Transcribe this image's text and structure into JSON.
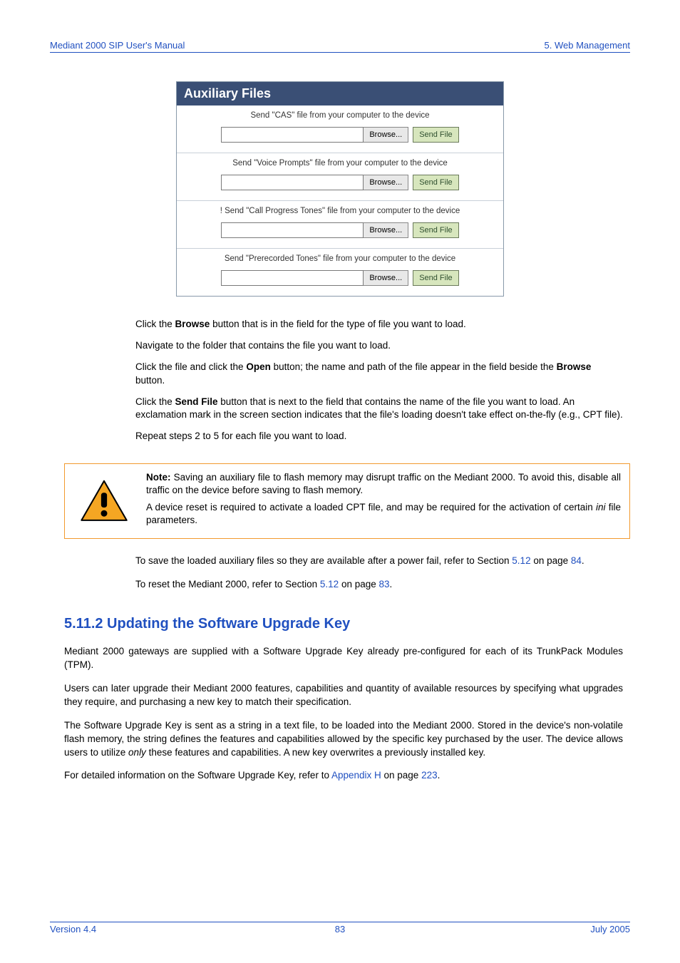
{
  "header": {
    "left": "Mediant 2000 SIP User's Manual",
    "right": "5. Web Management"
  },
  "aux": {
    "title": "Auxiliary Files",
    "sections": [
      {
        "label": "Send \"CAS\" file from your computer to the device",
        "browse": "Browse...",
        "send": "Send File"
      },
      {
        "label": "Send \"Voice Prompts\" file from your computer to the device",
        "browse": "Browse...",
        "send": "Send File"
      },
      {
        "label": "! Send \"Call Progress Tones\" file from your computer to the device",
        "browse": "Browse...",
        "send": "Send File"
      },
      {
        "label": "Send \"Prerecorded Tones\" file from your computer to the device",
        "browse": "Browse...",
        "send": "Send File"
      }
    ]
  },
  "steps": {
    "s2a": "Click the ",
    "s2b": "Browse",
    "s2c": " button that is in the field for the type of file you want to load.",
    "s3": "Navigate to the folder that contains the file you want to load.",
    "s4a": "Click the file and click the ",
    "s4b": "Open",
    "s4c": " button; the name and path of the file appear in the field beside the ",
    "s4d": "Browse",
    "s4e": " button.",
    "s5a": "Click the ",
    "s5b": "Send File",
    "s5c": " button that is next to the field that contains the name of the file you want to load. An exclamation mark in the screen section indicates that the file's loading doesn't take effect on-the-fly (e.g., CPT file).",
    "s6": "Repeat steps 2 to 5 for each file you want to load."
  },
  "note": {
    "label": "Note:",
    "p1": " Saving an auxiliary file to flash memory may disrupt traffic on the Mediant 2000. To avoid this, disable all traffic on the device before saving to flash memory.",
    "p2a": "A device reset is required to activate a loaded CPT file, and may be required for the activation of certain ",
    "p2b": "ini",
    "p2c": " file parameters."
  },
  "after": {
    "p1a": "To save the loaded auxiliary files so they are available after a power fail, refer to Section ",
    "p1b": "5.12",
    "p1c": " on page ",
    "p1d": "84",
    "p1e": ".",
    "p2a": "To reset the Mediant 2000, refer to Section ",
    "p2b": "5.12",
    "p2c": " on page ",
    "p2d": "83",
    "p2e": "."
  },
  "section": {
    "heading": "5.11.2   Updating the Software Upgrade Key",
    "p1": "Mediant 2000 gateways are supplied with a Software Upgrade Key already pre-configured for each of its TrunkPack Modules (TPM).",
    "p2": "Users can later upgrade their Mediant 2000 features, capabilities and quantity of available resources by specifying what upgrades they require, and purchasing a new key to match their specification.",
    "p3a": "The Software Upgrade Key is sent as a string in a text file, to be loaded into the Mediant 2000. Stored in the device's non-volatile flash memory, the string defines the features and capabilities allowed by the specific key purchased by the user. The device allows users to utilize ",
    "p3b": "only",
    "p3c": " these features and capabilities. A new key overwrites a previously installed key.",
    "p4a": "For detailed information on the Software Upgrade Key, refer to ",
    "p4b": "Appendix H",
    "p4c": " on page ",
    "p4d": "223",
    "p4e": "."
  },
  "footer": {
    "left": "Version 4.4",
    "center": "83",
    "right": "July 2005"
  }
}
